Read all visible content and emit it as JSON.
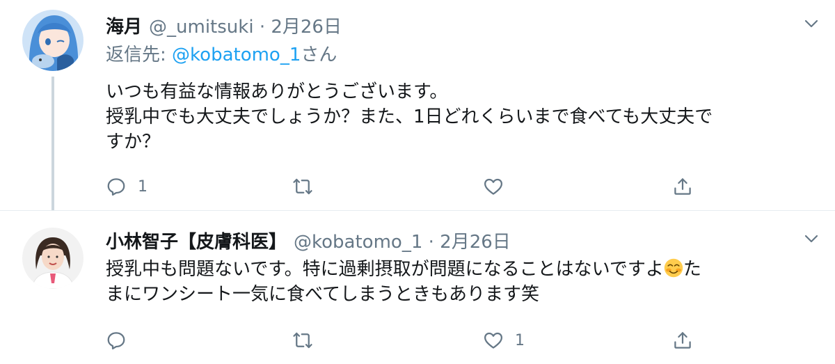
{
  "tweets": [
    {
      "name": "海月",
      "handle": "@_umitsuki",
      "dot": "·",
      "date": "2月26日",
      "reply_to_label": "返信先:",
      "reply_to_handle": "@kobatomo_1",
      "reply_to_suffix": "さん",
      "text_lines": [
        "いつも有益な情報ありがとうございます。",
        "授乳中でも大丈夫でしょうか？また、1日どれくらいまで食べても大丈夫で",
        "すか？"
      ],
      "reply_count": "1",
      "retweet_count": "",
      "like_count": ""
    },
    {
      "name": "小林智子【皮膚科医】",
      "handle": "@kobatomo_1",
      "dot": "·",
      "date": "2月26日",
      "text_line1_before_emoji": "授乳中も問題ないです。特に過剰摂取が問題になることはないですよ",
      "text_line1_after_emoji": "た",
      "text_line2": "まにワンシート一気に食べてしまうときもあります笑",
      "emoji": "smiling-face-with-blush",
      "reply_count": "",
      "retweet_count": "",
      "like_count": "1"
    }
  ],
  "icons": {
    "reply": "reply-icon",
    "retweet": "retweet-icon",
    "like": "heart-icon",
    "share": "share-icon",
    "caret": "chevron-down-icon"
  },
  "colors": {
    "text": "#14171a",
    "secondary": "#657786",
    "link": "#1da1f2",
    "thread_line": "#ccd6dd"
  }
}
